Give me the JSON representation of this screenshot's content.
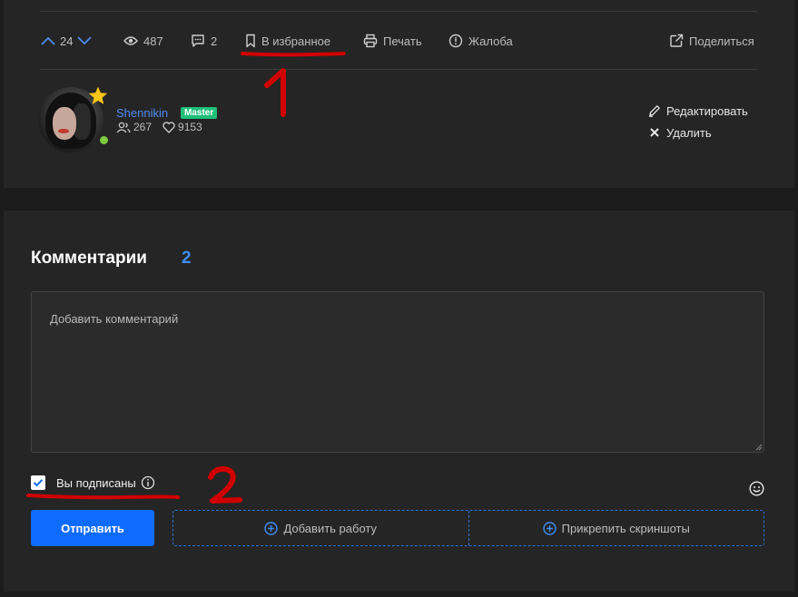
{
  "toolbar": {
    "votes": "24",
    "views": "487",
    "comments": "2",
    "favorite": "В избранное",
    "print": "Печать",
    "complaint": "Жалоба",
    "share": "Поделиться"
  },
  "annotations": {
    "mark1": "1",
    "mark2": "2",
    "color": "#d10000"
  },
  "author": {
    "name": "Shennikin",
    "badge": "Master",
    "followers": "267",
    "likes": "9153",
    "edit": "Редактировать",
    "delete": "Удалить"
  },
  "comments": {
    "title": "Комментарии",
    "count": "2",
    "placeholder": "Добавить комментарий",
    "subscribed": "Вы подписаны",
    "send": "Отправить",
    "add_work": "Добавить работу",
    "attach_screens": "Прикрепить скриншоты"
  },
  "colors": {
    "accent": "#0e6bff",
    "link": "#4f8df0",
    "badge": "#1fbf7a",
    "online": "#7ccc3d",
    "star": "#f5c518"
  }
}
